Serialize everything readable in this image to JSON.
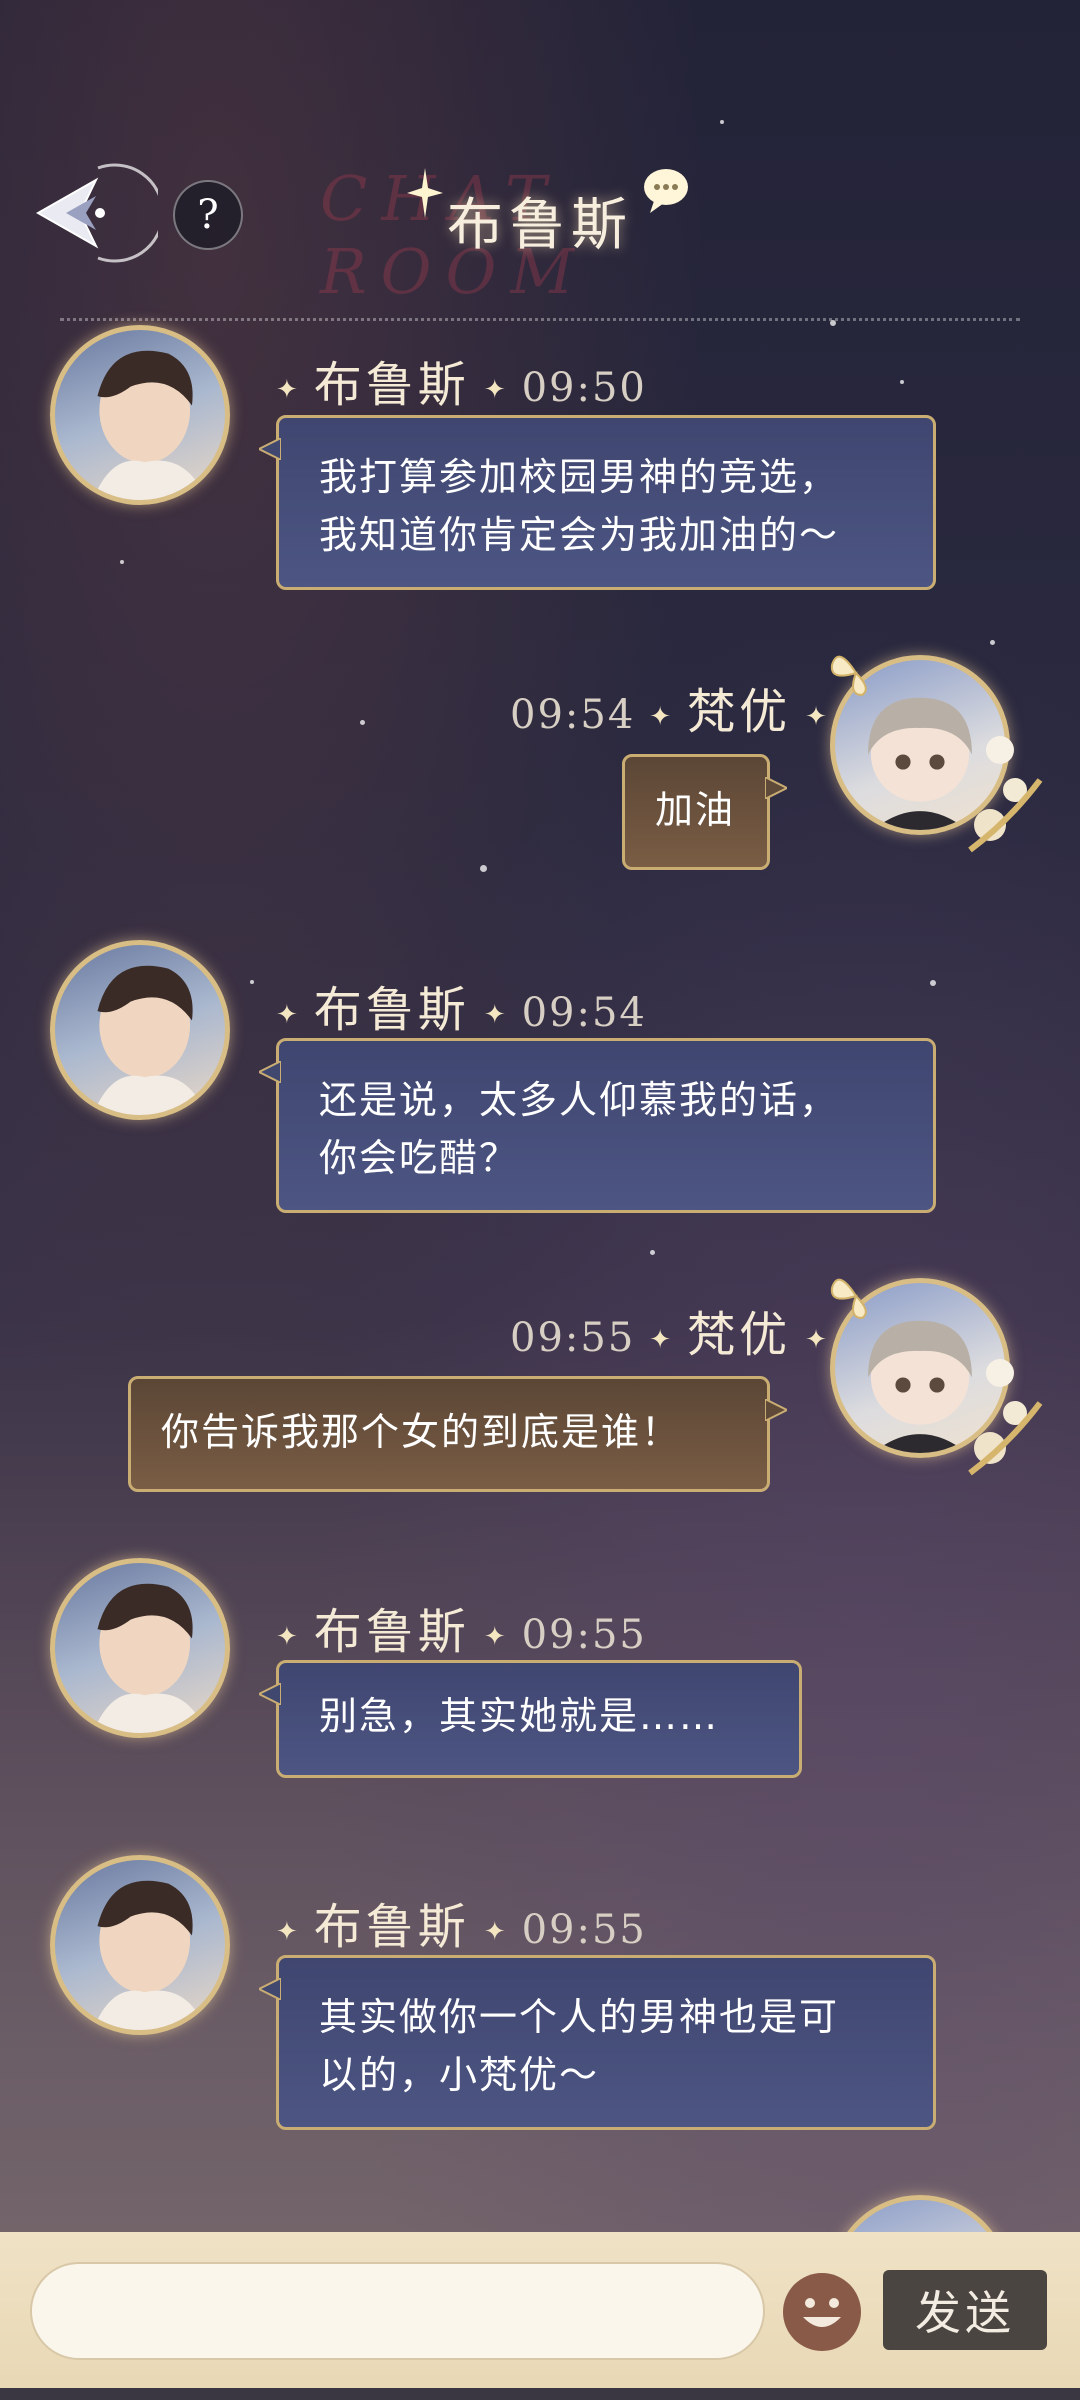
{
  "header": {
    "title": "布鲁斯",
    "watermark": "CHAT ROOM",
    "help_label": "?"
  },
  "messages": [
    {
      "sender": "布鲁斯",
      "side": "left",
      "time": "09:50",
      "text_lines": [
        "我打算参加校园男神的竞选，",
        "我知道你肯定会为我加油的～"
      ]
    },
    {
      "sender": "梵优",
      "side": "right",
      "time": "09:54",
      "text_lines": [
        "加油"
      ]
    },
    {
      "sender": "布鲁斯",
      "side": "left",
      "time": "09:54",
      "text_lines": [
        "还是说，太多人仰慕我的话，",
        "你会吃醋？"
      ]
    },
    {
      "sender": "梵优",
      "side": "right",
      "time": "09:55",
      "text_lines": [
        "你告诉我那个女的到底是谁！"
      ]
    },
    {
      "sender": "布鲁斯",
      "side": "left",
      "time": "09:55",
      "text_lines": [
        "别急，其实她就是……"
      ]
    },
    {
      "sender": "布鲁斯",
      "side": "left",
      "time": "09:55",
      "text_lines": [
        "其实做你一个人的男神也是可",
        "以的，小梵优～"
      ]
    }
  ],
  "input": {
    "placeholder": "",
    "send_label": "发送"
  },
  "icons": {
    "back": "back-arrow-icon",
    "help": "help-icon",
    "emoji": "emoji-icon",
    "title_bubble": "chat-bubble-icon"
  },
  "colors": {
    "male_bubble": "#45507c",
    "female_bubble": "#6a5140",
    "bubble_border": "#c9ad73",
    "input_bar": "#ecdcbd",
    "send_button": "#4a4540"
  }
}
